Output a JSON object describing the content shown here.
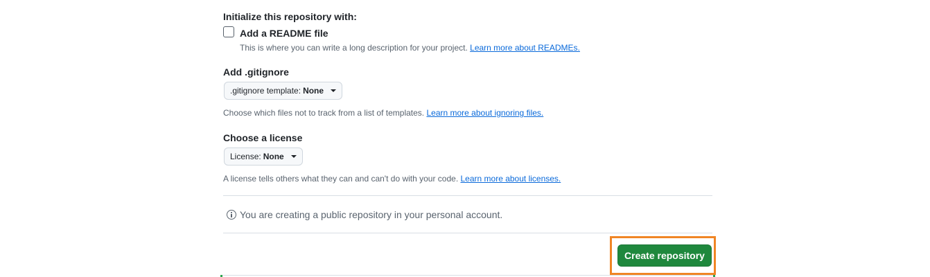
{
  "init": {
    "heading": "Initialize this repository with:",
    "readme_label": "Add a README file",
    "readme_checked": false,
    "readme_note": "This is where you can write a long description for your project. ",
    "readme_link": "Learn more about READMEs."
  },
  "gitignore": {
    "heading": "Add .gitignore",
    "dropdown_prefix": ".gitignore template:",
    "dropdown_value": "None",
    "note": "Choose which files not to track from a list of templates. ",
    "link": "Learn more about ignoring files."
  },
  "license": {
    "heading": "Choose a license",
    "dropdown_prefix": "License:",
    "dropdown_value": "None",
    "note": "A license tells others what they can and can't do with your code. ",
    "link": "Learn more about licenses."
  },
  "info": {
    "icon": "info-icon",
    "text": "You are creating a public repository in your personal account."
  },
  "actions": {
    "create_label": "Create repository",
    "button_color": "#1f883d",
    "highlight_color": "#f08524"
  },
  "colors": {
    "link": "#0969da",
    "muted": "#59636e",
    "text": "#1f2328"
  }
}
